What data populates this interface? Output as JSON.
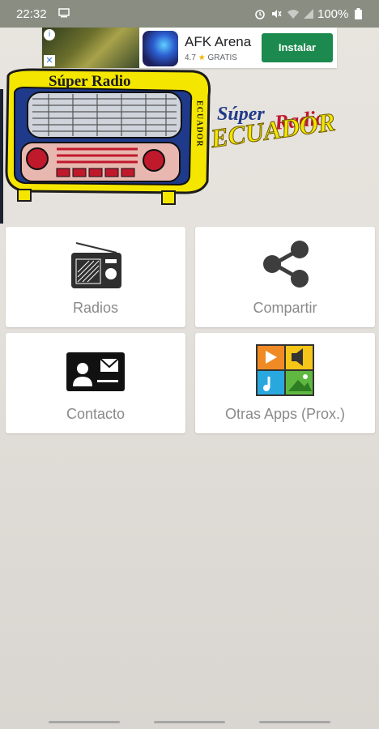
{
  "status_bar": {
    "time": "22:32",
    "battery_text": "100%"
  },
  "ad": {
    "app_name": "AFK Arena",
    "rating": "4.7",
    "price_label": "GRATIS",
    "install_label": "Instalar",
    "install_color": "#1c8a4e"
  },
  "logo": {
    "radio_top_text": "Súper Radio",
    "radio_side_text": "ECUADOR",
    "title_line1_a": "Súper",
    "title_line1_b": "Radio",
    "title_line2": "ECUADOR",
    "colors": {
      "blue": "#1f3a8a",
      "red": "#c0192c",
      "yellow": "#f5e600"
    }
  },
  "menu": {
    "items": [
      {
        "label": "Radios",
        "icon": "radio-icon"
      },
      {
        "label": "Compartir",
        "icon": "share-icon"
      },
      {
        "label": "Contacto",
        "icon": "contact-card-icon"
      },
      {
        "label": "Otras Apps (Prox.)",
        "icon": "media-apps-icon"
      }
    ]
  }
}
